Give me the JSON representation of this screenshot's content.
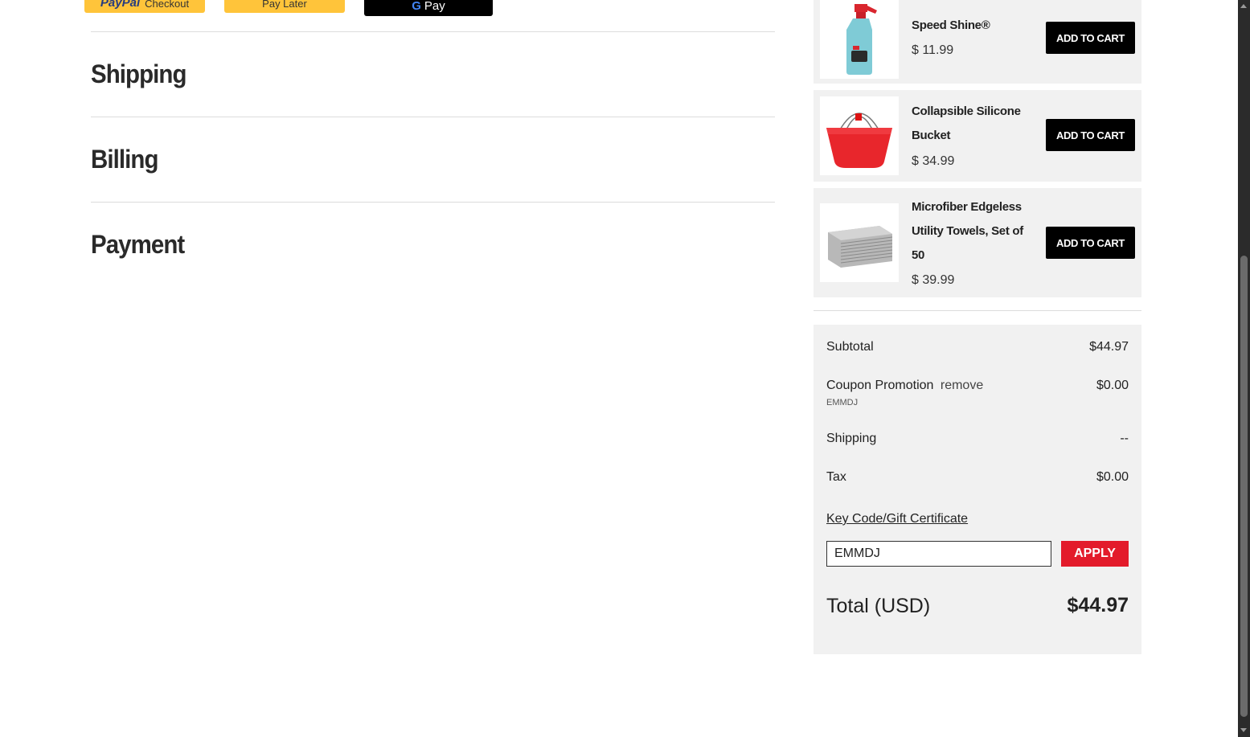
{
  "express_checkout": {
    "paypal_logo": "PayPal",
    "paypal_label": "Checkout",
    "paylater_label": "Pay Later",
    "gpay_label": "Pay"
  },
  "sections": {
    "shipping": "Shipping",
    "billing": "Billing",
    "payment": "Payment"
  },
  "recommendations": [
    {
      "name": "Speed Shine®",
      "price": "$ 11.99",
      "button": "ADD TO CART",
      "icon": "spray-bottle-icon"
    },
    {
      "name": "Collapsible Silicone Bucket",
      "price": "$ 34.99",
      "button": "ADD TO CART",
      "icon": "bucket-icon"
    },
    {
      "name": "Microfiber Edgeless Utility Towels, Set of 50",
      "price": "$ 39.99",
      "button": "ADD TO CART",
      "icon": "towels-icon"
    }
  ],
  "summary": {
    "subtotal_label": "Subtotal",
    "subtotal_value": "$44.97",
    "coupon_label": "Coupon Promotion",
    "coupon_remove": "remove",
    "coupon_code": "EMMDJ",
    "coupon_value": "$0.00",
    "shipping_label": "Shipping",
    "shipping_value": "--",
    "tax_label": "Tax",
    "tax_value": "$0.00",
    "keycode_link": "Key Code/Gift Certificate",
    "keycode_input_value": "EMMDJ",
    "apply_label": "APPLY",
    "total_label": "Total (USD)",
    "total_value": "$44.97"
  },
  "colors": {
    "paypal_yellow": "#ffc43a",
    "apply_red": "#e31b2b",
    "card_bg": "#f1f1f1"
  }
}
